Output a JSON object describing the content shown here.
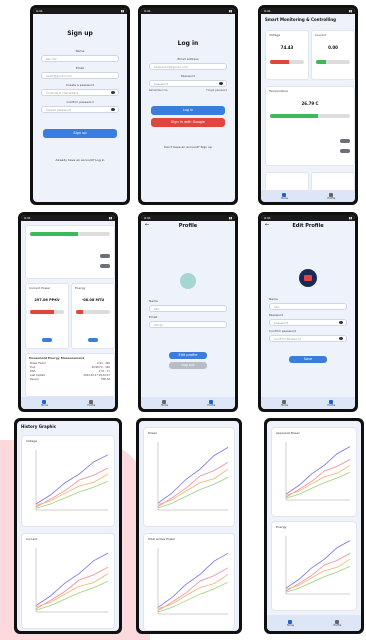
{
  "signup": {
    "title": "Sign up",
    "name_label": "Name",
    "name_value": "Abc dd",
    "email_label": "Email",
    "email_value": "hello@gmail.com",
    "password_label": "Create a password",
    "password_placeholder": "must be 8 characters",
    "confirm_label": "Confirm password",
    "confirm_placeholder": "repeat password",
    "button": "Sign up",
    "footer": "Already have an account? Log in"
  },
  "login": {
    "title": "Log in",
    "email_label": "Email address",
    "email_value": "helloworld@gmail.com",
    "password_label": "Password",
    "password_value": "password",
    "remember": "Remember me",
    "forgot": "Forgot password",
    "login_button": "Log in",
    "google_button": "Sign in with Google",
    "footer": "Don't have an account? Sign up"
  },
  "dashboard": {
    "title": "Smart Monitoring & Controlling",
    "card1_title": "Voltage",
    "card1_value": "74.43",
    "card2_title": "Current",
    "card2_value": "0.00",
    "temp_title": "Temperature",
    "temp_value": "26.79 C",
    "bar_labels": [
      "Low",
      "Medium",
      "High"
    ],
    "nav_home": "Home",
    "nav_profile": "Profile"
  },
  "dashboard2": {
    "power_title": "Current Power",
    "power_value": "297.06 PPKV",
    "energy_title": "Energy",
    "energy_value": "-08.08 MTU",
    "table_title": "Household Energy Measurement",
    "rows": [
      [
        "Power Factor",
        "0.92 - 100"
      ],
      [
        "Freq",
        "49.98 Hz - 100"
      ],
      [
        "kWh",
        "1.57 - 71"
      ],
      [
        "Last Update",
        "2024-03-17 09:32:47"
      ],
      [
        "Device",
        "ESP-32"
      ]
    ],
    "nav_home": "Home",
    "nav_profile": "Profile"
  },
  "profile": {
    "title": "Profile",
    "name_label": "Name",
    "name_value": "Abc",
    "email_label": "Email",
    "email_value": "Abc@",
    "edit_button": "Edit profile",
    "logout_button": "Log out",
    "nav_home": "Home",
    "nav_profile": "Profile"
  },
  "edit_profile": {
    "title": "Edit Profile",
    "name_label": "Name",
    "name_value": "Abc",
    "password_label": "Password",
    "password_value": "password",
    "confirm_label": "Confirm password",
    "confirm_value": "Confirm Password",
    "save_button": "Save",
    "nav_home": "Home",
    "nav_profile": "Profile"
  },
  "history": {
    "title": "History Graphic",
    "graphs_col1": [
      "Voltage",
      "Current"
    ],
    "graphs_col2": [
      "Power",
      "Total Active Power"
    ],
    "graphs_col3": [
      "Apparent Power",
      "Energy"
    ],
    "nav_home": "Home",
    "nav_profile": "Profile"
  },
  "colors": {
    "accent": "#3b7ddd",
    "danger": "#e0463c",
    "line1": "#7b6ee8",
    "line2": "#f08aa0",
    "line3": "#f5b26a",
    "line4": "#9bd17c"
  }
}
